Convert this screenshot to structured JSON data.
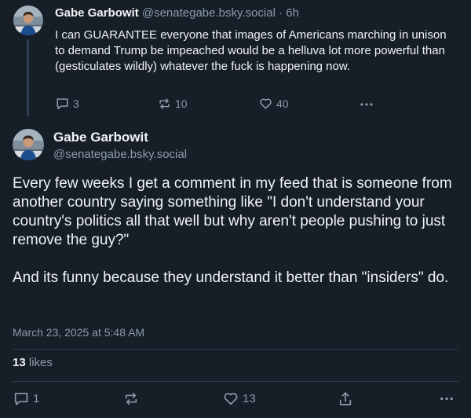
{
  "parent_post": {
    "author_name": "Gabe Garbowit",
    "author_handle": "@senategabe.bsky.social",
    "separator": "·",
    "time_ago": "6h",
    "text": "I can GUARANTEE everyone that images of Americans marching in unison to demand Trump be impeached would be a helluva lot more powerful than (gesticulates wildly) whatever the fuck is happening now.",
    "replies": "3",
    "reposts": "10",
    "likes": "40",
    "icons": {
      "reply": "reply-icon",
      "repost": "repost-icon",
      "like": "heart-icon",
      "more": "more-icon"
    }
  },
  "main_post": {
    "author_name": "Gabe Garbowit",
    "author_handle": "@senategabe.bsky.social",
    "paragraph_1": "Every few weeks I get a comment in my feed that is someone from another country saying something like \"I don't understand your country's politics all that well but why aren't people pushing to just remove the guy?\"",
    "paragraph_2": "And its funny because they understand it better than \"insiders\" do.",
    "timestamp": "March 23, 2025 at 5:48 AM",
    "likes_count": "13",
    "likes_label": "likes",
    "replies": "1",
    "like_count_action": "13",
    "icons": {
      "reply": "reply-icon",
      "repost": "repost-icon",
      "like": "heart-icon",
      "share": "share-icon",
      "more": "more-icon"
    }
  },
  "colors": {
    "background": "#161e27",
    "text_primary": "#f1f3f5",
    "text_secondary": "#8c9baa",
    "divider": "#2e3a47"
  }
}
